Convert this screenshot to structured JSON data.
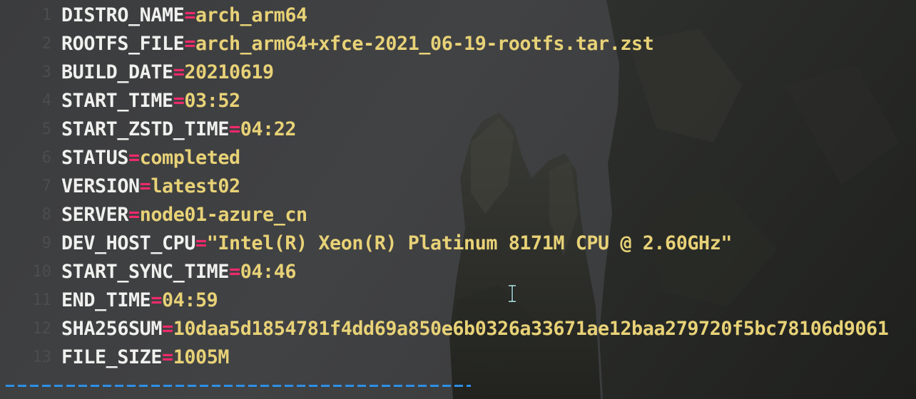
{
  "colors": {
    "background": "#3a3b3d",
    "key": "#f0f0ee",
    "operator": "#ef2a6a",
    "string_value": "#e8d277",
    "line_number": "#4c4d4d",
    "divider": "#2d8fe6"
  },
  "lines": [
    {
      "num": "1",
      "key": "DISTRO_NAME",
      "eq": "=",
      "value": "arch_arm64"
    },
    {
      "num": "2",
      "key": "ROOTFS_FILE",
      "eq": "=",
      "value": "arch_arm64+xfce-2021_06-19-rootfs.tar.zst"
    },
    {
      "num": "3",
      "key": "BUILD_DATE",
      "eq": "=",
      "value": "20210619"
    },
    {
      "num": "4",
      "key": "START_TIME",
      "eq": "=",
      "value": "03:52"
    },
    {
      "num": "5",
      "key": "START_ZSTD_TIME",
      "eq": "=",
      "value": "04:22"
    },
    {
      "num": "6",
      "key": "STATUS",
      "eq": "=",
      "value": "completed"
    },
    {
      "num": "7",
      "key": "VERSION",
      "eq": "=",
      "value": "latest02"
    },
    {
      "num": "8",
      "key": "SERVER",
      "eq": "=",
      "value": "node01-azure_cn"
    },
    {
      "num": "9",
      "key": "DEV_HOST_CPU",
      "eq": "=",
      "value": "\"Intel(R) Xeon(R) Platinum 8171M CPU @ 2.60GHz\""
    },
    {
      "num": "10",
      "key": "START_SYNC_TIME",
      "eq": "=",
      "value": "04:46"
    },
    {
      "num": "11",
      "key": "END_TIME",
      "eq": "=",
      "value": "04:59"
    },
    {
      "num": "12",
      "key": "SHA256SUM",
      "eq": "=",
      "value": "10daa5d1854781f4dd69a850e6b0326a33671ae12baa279720f5bc78106d9061"
    },
    {
      "num": "13",
      "key": "FILE_SIZE",
      "eq": "=",
      "value": "1005M"
    }
  ],
  "icons": {
    "cursor": "text-cursor-icon",
    "wallpaper": "rock-spire-wallpaper"
  }
}
